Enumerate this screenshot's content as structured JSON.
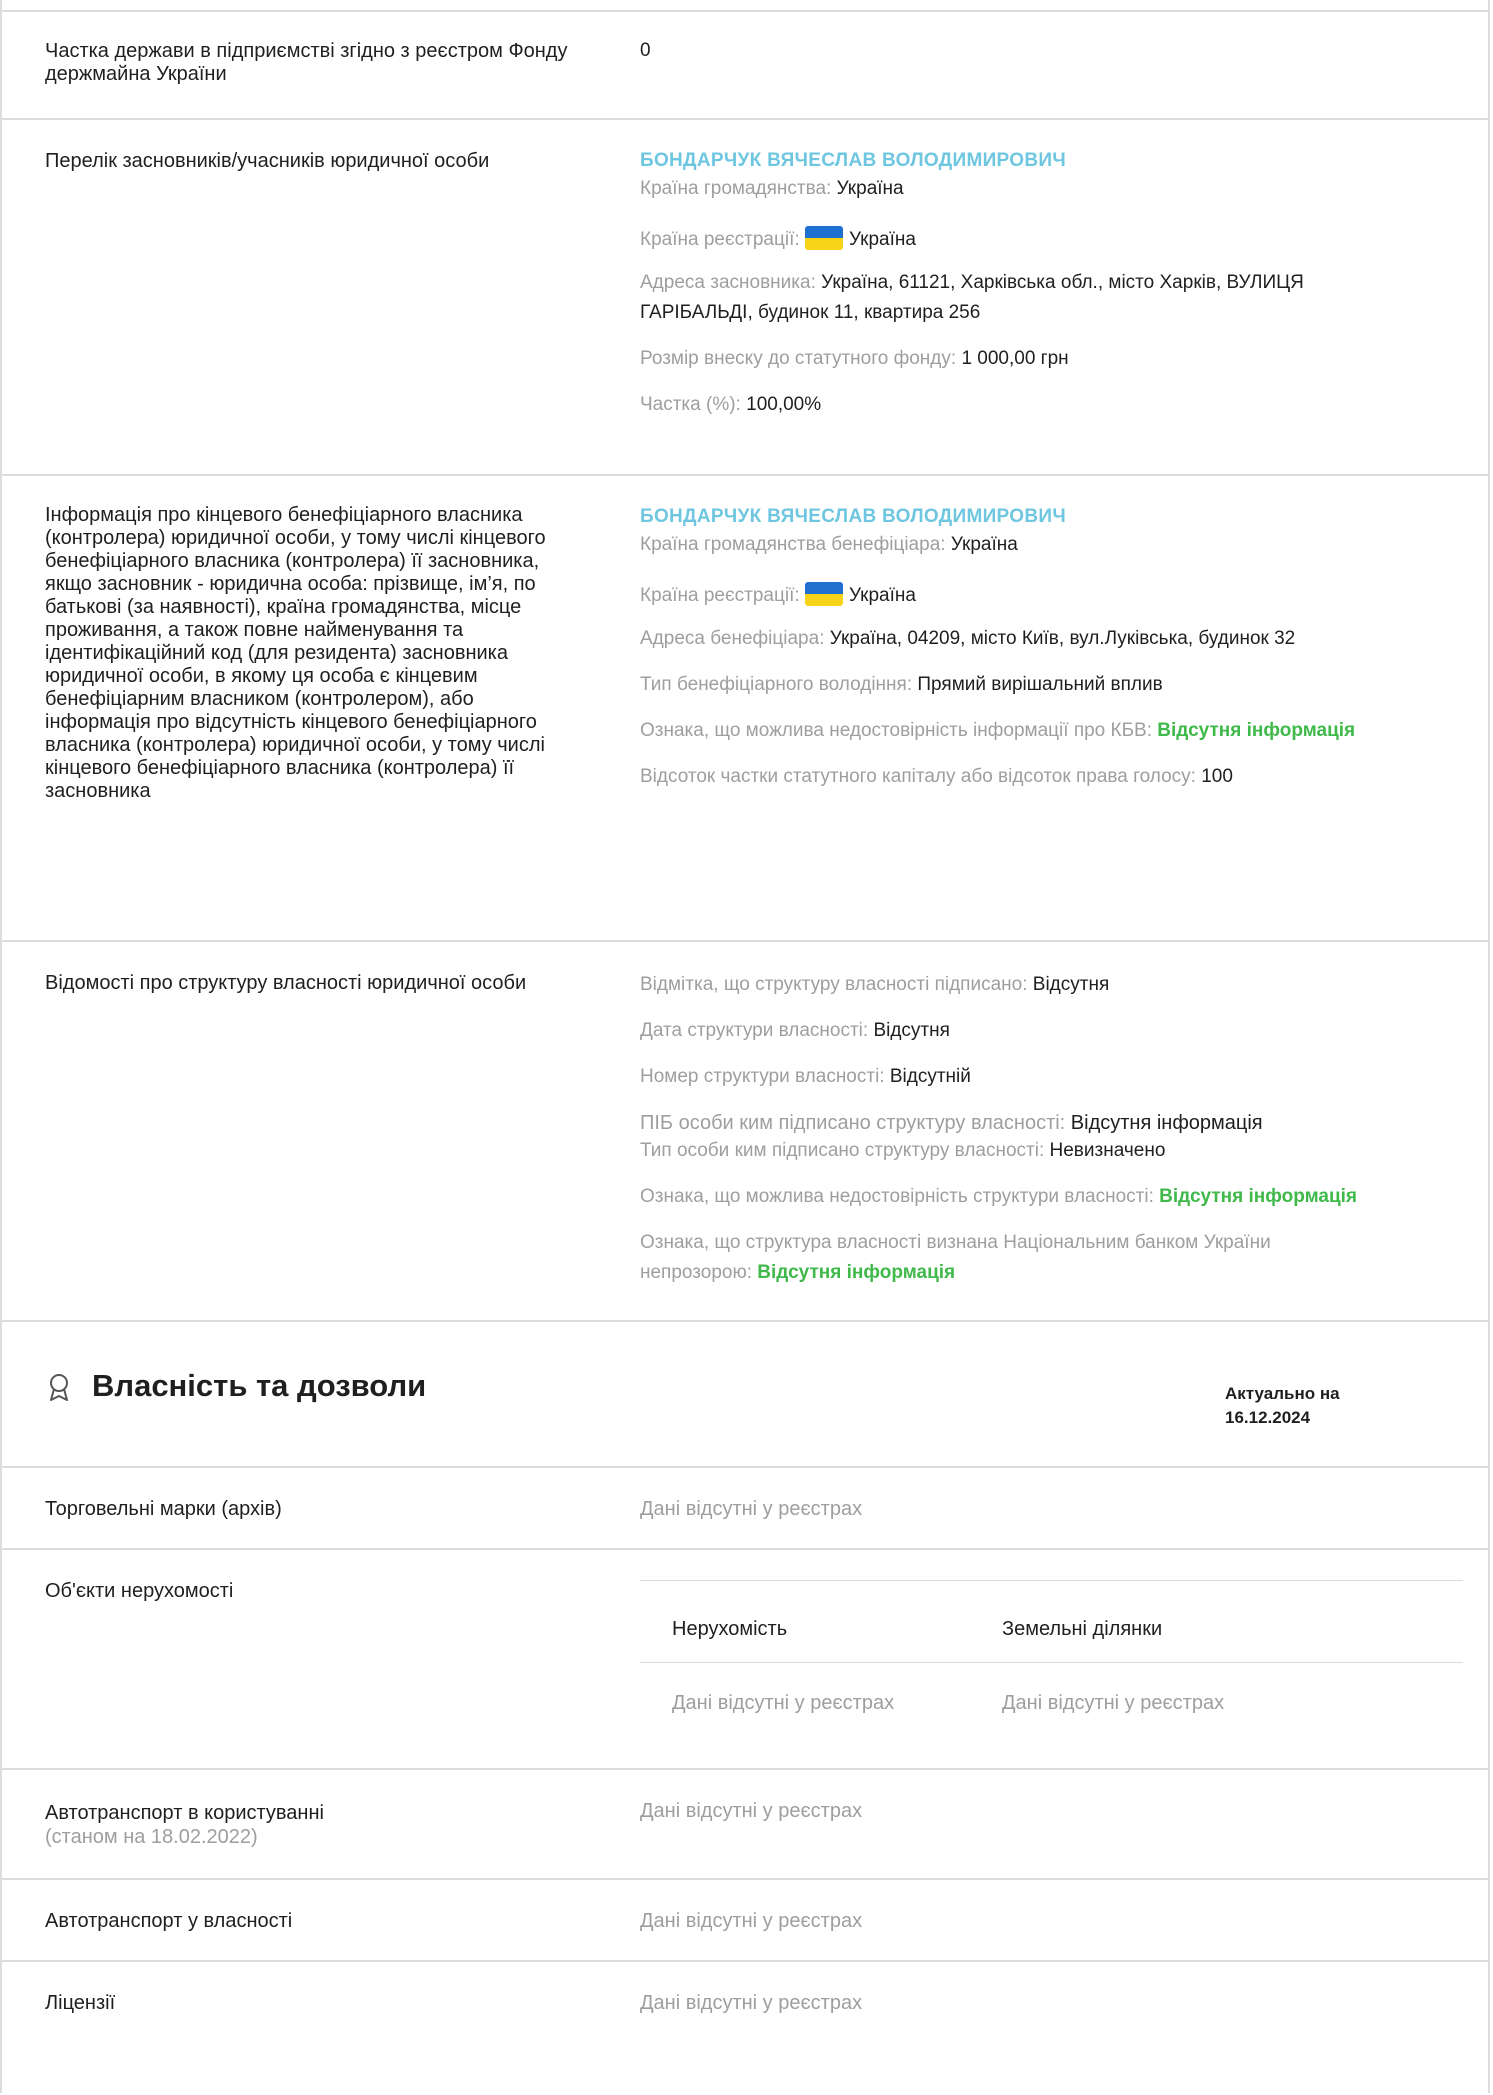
{
  "rows": {
    "state_share": {
      "label": "Частка держави в підприємстві згідно з реєстром Фонду держмайна України",
      "value": "0"
    },
    "founders": {
      "label": "Перелік засновників/учасників юридичної особи",
      "name": "БОНДАРЧУК ВЯЧЕСЛАВ ВОЛОДИМИРОВИЧ",
      "citizenship_label": "Країна громадянства:",
      "citizenship_value": "Україна",
      "reg_label": "Країна реєстрації:",
      "reg_value": "Україна",
      "address_label": "Адреса засновника:",
      "address_value": "Україна, 61121, Харківська обл., місто Харків, ВУЛИЦЯ",
      "address_value2": "ГАРІБАЛЬДІ, будинок 11, квартира 256",
      "contribution_label": "Розмір внеску до статутного фонду:",
      "contribution_value": "1 000,00 грн",
      "share_label": "Частка (%):",
      "share_value": "100,00%"
    },
    "beneficiary": {
      "label": "Інформація про кінцевого бенефіціарного власника (контролера) юридичної особи, у тому числі кінцевого бенефіціарного власника (контролера) її засновника, якщо засновник - юридична особа: прізвище, ім’я, по батькові (за наявності), країна громадянства, місце проживання, а також повне найменування та ідентифікаційний код (для резидента) засновника юридичної особи, в якому ця особа є кінцевим бенефіціарним власником (контролером), або інформація про відсутність кінцевого бенефіціарного власника (контролера) юридичної особи, у тому числі кінцевого бенефіціарного власника (контролера) її засновника",
      "name": "БОНДАРЧУК ВЯЧЕСЛАВ ВОЛОДИМИРОВИЧ",
      "citizenship_label": "Країна громадянства бенефіціара:",
      "citizenship_value": "Україна",
      "reg_label": "Країна реєстрації:",
      "reg_value": "Україна",
      "address_label": "Адреса бенефіціара:",
      "address_value": "Україна, 04209, місто Київ, вул.Луківська, будинок 32",
      "type_label": "Тип бенефіціарного володіння:",
      "type_value": "Прямий вирішальний вплив",
      "unreliable_label": "Ознака, що можлива недостовірність інформації про КБВ:",
      "unreliable_value": "Відсутня інформація",
      "percent_label": "Відсоток частки статутного капіталу або відсоток права голосу:",
      "percent_value": "100"
    },
    "structure": {
      "label": "Відомості про структуру власності юридичної особи",
      "signed_label": "Відмітка, що структуру власності підписано:",
      "signed_value": "Відсутня",
      "date_label": "Дата структури власності:",
      "date_value": "Відсутня",
      "number_label": "Номер структури власності:",
      "number_value": "Відсутній",
      "signer_label": "ПІБ особи ким підписано структуру власності:",
      "signer_value": "Відсутня інформація",
      "signer_type_label": "Тип особи ким підписано структуру власності:",
      "signer_type_value": "Невизначено",
      "unreliable_label": "Ознака, що можлива недостовірність структури власності:",
      "unreliable_value": "Відсутня інформація",
      "opaque_label": "Ознака, що структура власності визнана Національним банком України",
      "opaque_label2": "непрозорою:",
      "opaque_value": "Відсутня інформація"
    }
  },
  "section": {
    "title": "Власність та дозволи",
    "icon": "award-icon",
    "actual_label": "Актуально на",
    "actual_date": "16.12.2024"
  },
  "property": {
    "trademarks": {
      "label": "Торговельні марки (архів)",
      "value": "Дані відсутні у реєстрах"
    },
    "realty": {
      "label": "Об'єкти нерухомості",
      "col1": "Нерухомість",
      "col2": "Земельні ділянки",
      "val1": "Дані відсутні у реєстрах",
      "val2": "Дані відсутні у реєстрах"
    },
    "vehicles_use": {
      "label": "Автотранспорт в користуванні",
      "sub": "(станом на 18.02.2022)",
      "value": "Дані відсутні у реєстрах"
    },
    "vehicles_own": {
      "label": "Автотранспорт у власності",
      "value": "Дані відсутні у реєстрах"
    },
    "licenses": {
      "label": "Ліцензії",
      "value": "Дані відсутні у реєстрах"
    }
  }
}
